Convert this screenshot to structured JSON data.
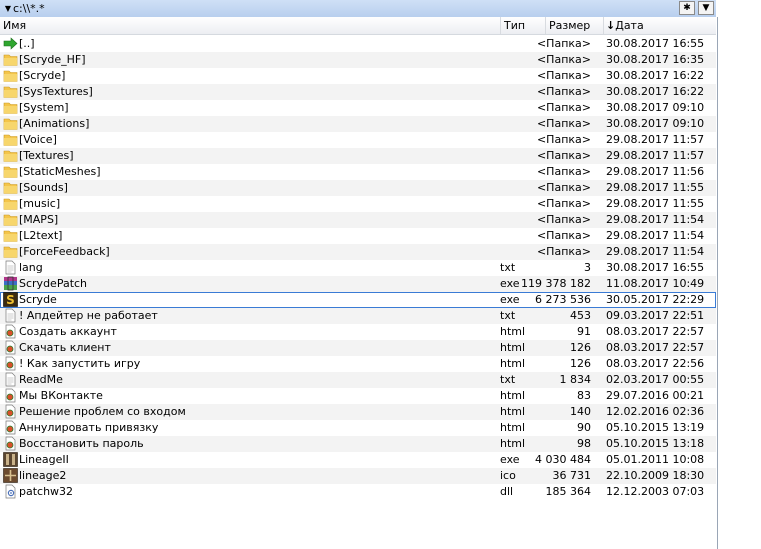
{
  "path_bar": {
    "path": "c:\\\\*.*",
    "left_icon": "triangle-down-icon"
  },
  "window_buttons": {
    "star_icon": "asterisk-icon",
    "menu_icon": "triangle-down-icon"
  },
  "columns": {
    "name": "Имя",
    "type": "Тип",
    "size": "Размер",
    "date": "Дата",
    "sort_icon": "arrow-down-icon"
  },
  "colors": {
    "path_bar": "#c3d6f1",
    "selection_border": "#3a7bd5",
    "alt_row": "#f3f3f3",
    "folder": "#f4c54a"
  },
  "files": [
    {
      "name": "[..]",
      "type": "",
      "size": "<Папка>",
      "date": "30.08.2017 16:55",
      "icon": "up-arrow-icon"
    },
    {
      "name": "[Scryde_HF]",
      "type": "",
      "size": "<Папка>",
      "date": "30.08.2017 16:35",
      "icon": "folder-icon"
    },
    {
      "name": "[Scryde]",
      "type": "",
      "size": "<Папка>",
      "date": "30.08.2017 16:22",
      "icon": "folder-icon"
    },
    {
      "name": "[SysTextures]",
      "type": "",
      "size": "<Папка>",
      "date": "30.08.2017 16:22",
      "icon": "folder-icon"
    },
    {
      "name": "[System]",
      "type": "",
      "size": "<Папка>",
      "date": "30.08.2017 09:10",
      "icon": "folder-icon"
    },
    {
      "name": "[Animations]",
      "type": "",
      "size": "<Папка>",
      "date": "30.08.2017 09:10",
      "icon": "folder-icon"
    },
    {
      "name": "[Voice]",
      "type": "",
      "size": "<Папка>",
      "date": "29.08.2017 11:57",
      "icon": "folder-icon"
    },
    {
      "name": "[Textures]",
      "type": "",
      "size": "<Папка>",
      "date": "29.08.2017 11:57",
      "icon": "folder-icon"
    },
    {
      "name": "[StaticMeshes]",
      "type": "",
      "size": "<Папка>",
      "date": "29.08.2017 11:56",
      "icon": "folder-icon"
    },
    {
      "name": "[Sounds]",
      "type": "",
      "size": "<Папка>",
      "date": "29.08.2017 11:55",
      "icon": "folder-icon"
    },
    {
      "name": "[music]",
      "type": "",
      "size": "<Папка>",
      "date": "29.08.2017 11:55",
      "icon": "folder-icon"
    },
    {
      "name": "[MAPS]",
      "type": "",
      "size": "<Папка>",
      "date": "29.08.2017 11:54",
      "icon": "folder-icon"
    },
    {
      "name": "[L2text]",
      "type": "",
      "size": "<Папка>",
      "date": "29.08.2017 11:54",
      "icon": "folder-icon"
    },
    {
      "name": "[ForceFeedback]",
      "type": "",
      "size": "<Папка>",
      "date": "29.08.2017 11:54",
      "icon": "folder-icon"
    },
    {
      "name": "lang",
      "type": "txt",
      "size": "3",
      "date": "30.08.2017 16:55",
      "icon": "text-file-icon"
    },
    {
      "name": "ScrydePatch",
      "type": "exe",
      "size": "119 378 182",
      "date": "11.08.2017 10:49",
      "icon": "archive-exe-icon"
    },
    {
      "name": "Scryde",
      "type": "exe",
      "size": "6 273 536",
      "date": "30.05.2017 22:29",
      "icon": "scryde-app-icon",
      "selected": true
    },
    {
      "name": "! Апдейтер не работает",
      "type": "txt",
      "size": "453",
      "date": "09.03.2017 22:51",
      "icon": "text-file-icon"
    },
    {
      "name": "Создать аккаунт",
      "type": "html",
      "size": "91",
      "date": "08.03.2017 22:57",
      "icon": "html-file-icon"
    },
    {
      "name": "Скачать клиент",
      "type": "html",
      "size": "126",
      "date": "08.03.2017 22:57",
      "icon": "html-file-icon"
    },
    {
      "name": "! Как запустить игру",
      "type": "html",
      "size": "126",
      "date": "08.03.2017 22:56",
      "icon": "html-file-icon"
    },
    {
      "name": "ReadMe",
      "type": "txt",
      "size": "1 834",
      "date": "02.03.2017 00:55",
      "icon": "text-file-icon"
    },
    {
      "name": "Мы ВКонтакте",
      "type": "html",
      "size": "83",
      "date": "29.07.2016 00:21",
      "icon": "html-file-icon"
    },
    {
      "name": "Решение проблем со входом",
      "type": "html",
      "size": "140",
      "date": "12.02.2016 02:36",
      "icon": "html-file-icon"
    },
    {
      "name": "Аннулировать привязку",
      "type": "html",
      "size": "90",
      "date": "05.10.2015 13:19",
      "icon": "html-file-icon"
    },
    {
      "name": "Восстановить пароль",
      "type": "html",
      "size": "98",
      "date": "05.10.2015 13:18",
      "icon": "html-file-icon"
    },
    {
      "name": "LineageII",
      "type": "exe",
      "size": "4 030 484",
      "date": "05.01.2011 10:08",
      "icon": "lineage-app-icon"
    },
    {
      "name": "lineage2",
      "type": "ico",
      "size": "36 731",
      "date": "22.10.2009 18:30",
      "icon": "lineage-ico-icon"
    },
    {
      "name": "patchw32",
      "type": "dll",
      "size": "185 364",
      "date": "12.12.2003 07:03",
      "icon": "dll-file-icon"
    }
  ]
}
